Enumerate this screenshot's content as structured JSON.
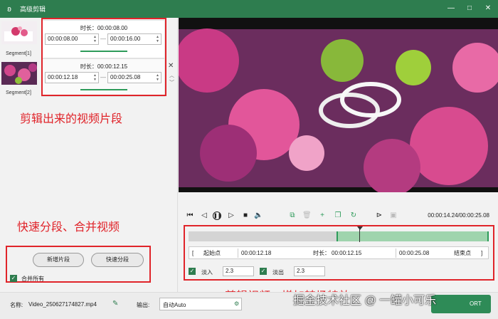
{
  "app": {
    "title": "高级剪辑",
    "icon": "rabbit-logo-icon"
  },
  "window": {
    "minimize": "—",
    "maximize": "□",
    "close": "✕"
  },
  "segments": [
    {
      "label": "Segment[1]",
      "duration": "时长：00:00:08.00",
      "start": "00:00:08.00",
      "end": "00:00:16.00"
    },
    {
      "label": "Segment[2]",
      "duration": "时长：00:00:12.15",
      "start": "00:00:12.18",
      "end": "00:00:25.08"
    }
  ],
  "annotations": {
    "segments": "剪辑出来的视频片段",
    "split_merge": "快速分段、合并视频",
    "transitions": "剪辑视频、增加转场特效"
  },
  "left_actions": {
    "new_segment": "新增片段",
    "quick_split": "快速分段",
    "merge_all": "合并所有"
  },
  "player": {
    "timecode": "00:00:14.24/00:00:25.08"
  },
  "range": {
    "start_label": "起始点",
    "start_value": "00:00:12.18",
    "duration_label": "时长：",
    "duration_value": "00:00:12.15",
    "end_value": "00:00:25.08",
    "end_label": "结束点",
    "bracket_left": "[",
    "bracket_right": "]"
  },
  "fade": {
    "fade_in_label": "淡入",
    "fade_in_value": "2.3",
    "fade_out_label": "淡出",
    "fade_out_value": "2.3"
  },
  "bottom": {
    "name_label": "名称:",
    "name_value": "Video_250627174827.mp4",
    "output_label": "输出:",
    "output_value": "自动Auto"
  },
  "watermark": "掘金技术社区 @ 一罐小可乐",
  "export_label": "ORT",
  "colors": {
    "accent": "#2e7d4f",
    "annotation": "#e0242a",
    "selection": "#9fd4ad"
  }
}
